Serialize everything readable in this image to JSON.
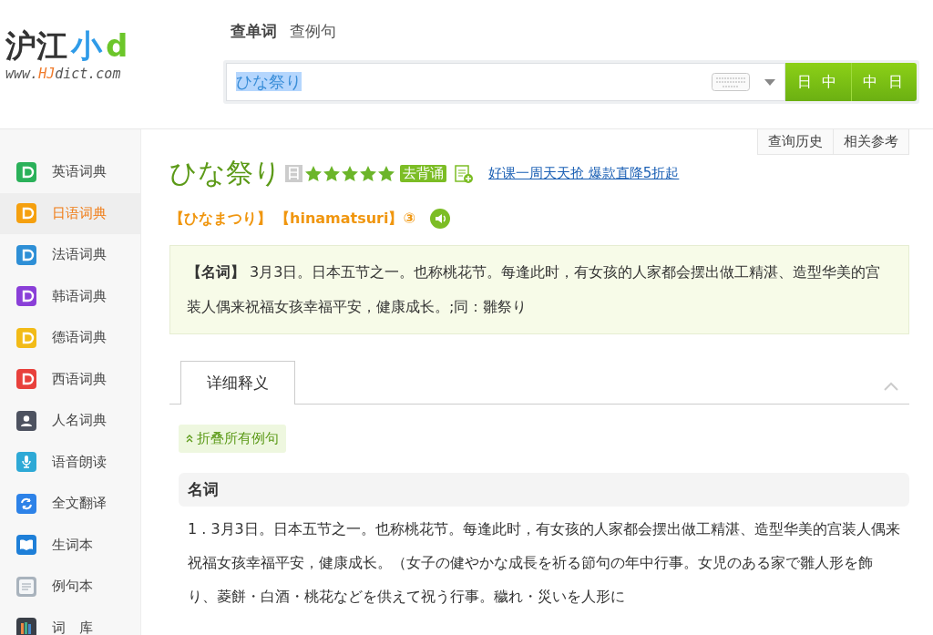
{
  "logo": {
    "parts": [
      {
        "text": "沪江",
        "kind": "dark"
      },
      {
        "text": "小",
        "kind": "blue"
      },
      {
        "text": "d",
        "kind": "green"
      }
    ],
    "url": [
      {
        "text": "www.",
        "kind": "grey"
      },
      {
        "text": "HJ",
        "kind": "orange"
      },
      {
        "text": "dict.com",
        "kind": "grey"
      }
    ]
  },
  "search_tabs": [
    {
      "label": "查单词",
      "selected": true
    },
    {
      "label": "查例句",
      "selected": false
    }
  ],
  "search": {
    "value": "ひな祭り",
    "selected_text": true
  },
  "search_buttons": [
    "日 中",
    "中 日"
  ],
  "top_links": [
    "查询历史",
    "相关参考"
  ],
  "sidebar": {
    "items": [
      {
        "label": "英语词典",
        "kind": "dict",
        "color": "#2bb15a",
        "selected": false
      },
      {
        "label": "日语词典",
        "kind": "dict",
        "color": "#f5a00f",
        "selected": true
      },
      {
        "label": "法语词典",
        "kind": "dict",
        "color": "#2e8fd6",
        "selected": false
      },
      {
        "label": "韩语词典",
        "kind": "dict",
        "color": "#8a3fd8",
        "selected": false
      },
      {
        "label": "德语词典",
        "kind": "dict",
        "color": "#f2bb17",
        "selected": false
      },
      {
        "label": "西语词典",
        "kind": "dict",
        "color": "#e8413c",
        "selected": false
      },
      {
        "label": "人名词典",
        "kind": "person",
        "color": "#4d5260",
        "selected": false
      },
      {
        "label": "语音朗读",
        "kind": "mic",
        "color": "#2ea9d6",
        "selected": false
      },
      {
        "label": "全文翻译",
        "kind": "translate",
        "color": "#2d82e8",
        "selected": false
      },
      {
        "label": "生词本",
        "kind": "book",
        "color": "#1e7fd8",
        "selected": false
      },
      {
        "label": "例句本",
        "kind": "notebook",
        "color": "#a9b3bd",
        "selected": false
      },
      {
        "label": "词　库",
        "kind": "library",
        "color": "#3a3f48",
        "selected": false
      }
    ]
  },
  "word": {
    "title": "ひな祭り",
    "lang_badge": "日",
    "stars": 5,
    "recite_badge": "去背诵",
    "promo_link": "好课一周天天抢 爆款直降5折起"
  },
  "pronunciation": {
    "kana": "【ひなまつり】",
    "romaji": "【hinamatsuri】③"
  },
  "summary": "**【名词】** 3月3日。日本五节之一。也称桃花节。每逢此时，有女孩的人家都会摆出做工精湛、造型华美的宫装人偶来祝福女孩幸福平安，健康成长。;同：雛祭り",
  "detail_tabs": [
    {
      "label": "详细释义",
      "selected": true
    }
  ],
  "collapse_button": "折叠所有例句",
  "section": {
    "heading": "名词",
    "text": "1 . 3月3日。日本五节之一。也称桃花节。每逢此时，有女孩的人家都会摆出做工精湛、造型华美的宫装人偶来祝福女孩幸福平安，健康成长。（女子の健やかな成長を祈る節句の年中行事。女児のある家で雛人形を飾り、菱餅・白酒・桃花などを供えて祝う行事。穢れ・災いを人形に"
  }
}
